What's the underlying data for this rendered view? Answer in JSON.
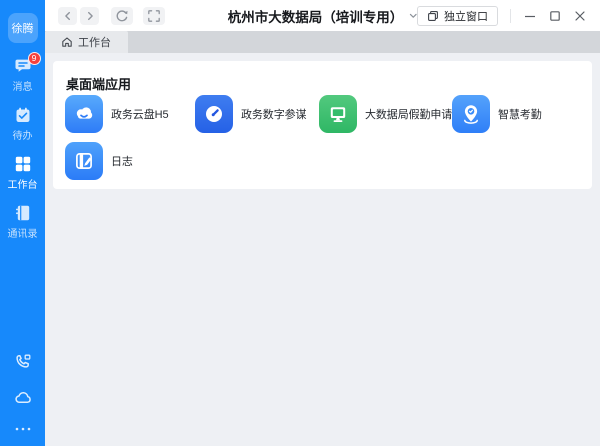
{
  "titlebar": {
    "title": "杭州市大数据局（培训专用）",
    "standalone_window": "独立窗口"
  },
  "tabbar": {
    "active_tab": "工作台"
  },
  "sidebar": {
    "avatar": "徐腾",
    "nav": [
      {
        "label": "消息",
        "icon": "chat-bubble-icon",
        "badge": "9"
      },
      {
        "label": "待办",
        "icon": "todo-calendar-check-icon"
      },
      {
        "label": "工作台",
        "icon": "workbench-grid-icon",
        "active": true
      },
      {
        "label": "通讯录",
        "icon": "contacts-book-icon"
      }
    ],
    "bottom_icons": [
      "phone-call-icon",
      "cloud-disk-icon",
      "more-dots-icon"
    ]
  },
  "workbench": {
    "section_title": "桌面端应用",
    "apps": [
      {
        "name": "政务云盘H5",
        "icon": "cloud-app-icon",
        "color": "#3a8ef9"
      },
      {
        "name": "政务数字参谋",
        "icon": "gauge-app-icon",
        "color": "#2c63e7"
      },
      {
        "name": "大数据局假勤申请",
        "icon": "monitor-app-icon",
        "color": "#3bbd6d"
      },
      {
        "name": "智慧考勤",
        "icon": "location-pin-check-app-icon",
        "color": "#3b8df9"
      },
      {
        "name": "日志",
        "icon": "journal-pen-app-icon",
        "color": "#338bf8"
      }
    ]
  },
  "colors": {
    "sidebar": "#1789fb",
    "badge": "#f5413d",
    "topbar_bg": "#ffffff",
    "tabbar_bg": "#d3d6da",
    "tab_active_bg": "#e7e9ec",
    "content_bg": "#eef0f4",
    "card_bg": "#ffffff"
  }
}
